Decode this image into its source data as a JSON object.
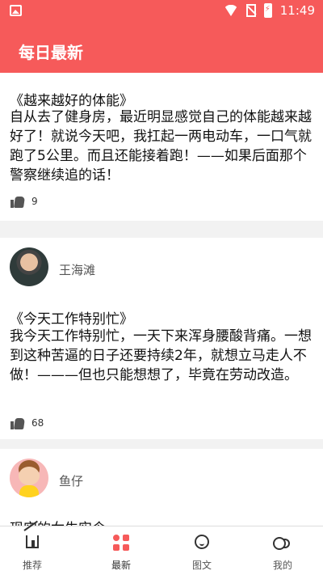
{
  "status": {
    "time": "11:49"
  },
  "header": {
    "title": "每日最新"
  },
  "posts": [
    {
      "title": "《越来越好的体能》",
      "body": "自从去了健身房，最近明显感觉自己的体能越来越好了！就说今天吧，我扛起一两电动车，一口气就跑了5公里。而且还能接着跑！——如果后面那个警察继续追的话！",
      "likes": "9"
    },
    {
      "user": "王海滩",
      "title": "《今天工作特别忙》",
      "body": "我今天工作特别忙，一天下来浑身腰酸背痛。一想到这种苦逼的日子还要持续2年，就想立马走人不做！———但也只能想想了，毕竟在劳动改造。",
      "likes": "68"
    },
    {
      "user": "鱼仔",
      "title": "现实的女生实令"
    }
  ],
  "tabs": [
    {
      "label": "推荐",
      "icon": "home-icon"
    },
    {
      "label": "最新",
      "icon": "grid-icon",
      "color": "#f65a5a"
    },
    {
      "label": "图文",
      "icon": "smile-icon"
    },
    {
      "label": "我的",
      "icon": "toggle-icon"
    }
  ],
  "colors": {
    "accent": "#f65a5a"
  }
}
